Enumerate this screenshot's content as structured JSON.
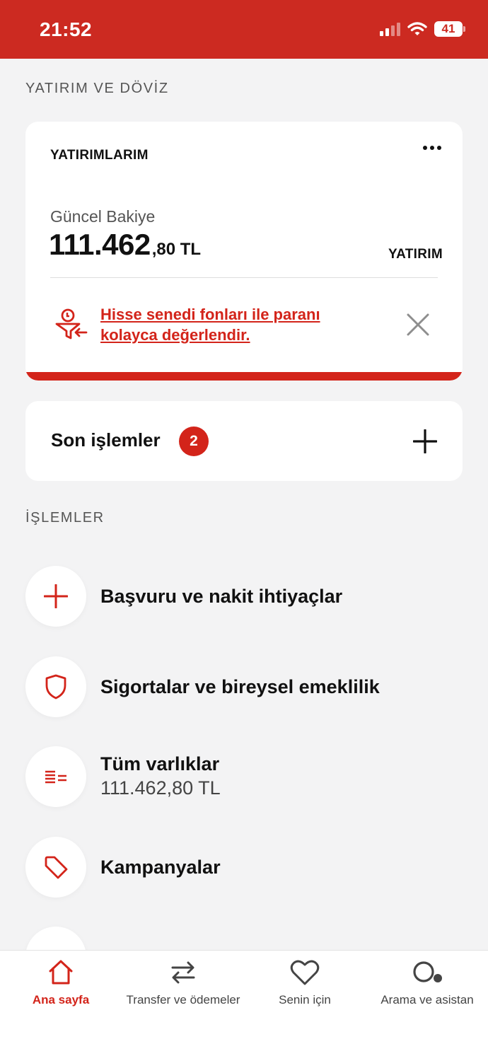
{
  "status": {
    "time": "21:52",
    "battery": "41"
  },
  "investment_section": {
    "title": "YATIRIM VE DÖVİZ",
    "card": {
      "title": "YATIRIMLARIM",
      "balance_label": "Güncel Bakiye",
      "balance_main": "111.462",
      "balance_rest": ",80 TL",
      "link_label": "YATIRIM",
      "promo_text": "Hisse senedi fonları ile paranı kolayca değerlendir."
    }
  },
  "recent": {
    "label": "Son işlemler",
    "count": "2"
  },
  "operations": {
    "title": "İŞLEMLER",
    "items": [
      {
        "label": "Başvuru ve nakit ihtiyaçlar",
        "icon": "plus-icon"
      },
      {
        "label": "Sigortalar ve bireysel emeklilik",
        "icon": "shield-icon"
      },
      {
        "label": "Tüm varlıklar",
        "sub": "111.462,80 TL",
        "icon": "list-icon"
      },
      {
        "label": "Kampanyalar",
        "icon": "tag-icon"
      }
    ]
  },
  "bottom_nav": [
    {
      "label": "Ana sayfa",
      "icon": "home-icon",
      "active": true
    },
    {
      "label": "Transfer ve ödemeler",
      "icon": "transfer-icon"
    },
    {
      "label": "Senin için",
      "icon": "heart-icon"
    },
    {
      "label": "Arama ve asistan",
      "icon": "search-assistant-icon"
    }
  ],
  "colors": {
    "brand_red": "#cc2a21",
    "accent_red": "#d3241a",
    "background": "#f3f3f4"
  }
}
